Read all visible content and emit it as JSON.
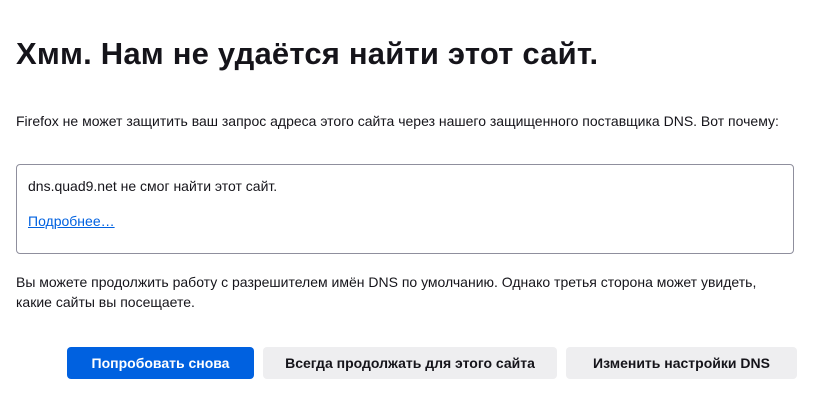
{
  "error_page": {
    "title": "Хмм. Нам не удаётся найти этот сайт.",
    "description": "Firefox не может защитить ваш запрос адреса этого сайта через нашего защищенного поставщика DNS. Вот почему:",
    "detail": {
      "message": "dns.quad9.net не смог найти этот сайт.",
      "learn_more_label": "Подробнее…"
    },
    "fallback_text": "Вы можете продолжить работу с разрешителем имён DNS по умолчанию. Однако третья сторона может увидеть, какие сайты вы посещаете."
  },
  "buttons": {
    "retry_label": "Попробовать снова",
    "always_continue_label": "Всегда продолжать для этого сайта",
    "dns_settings_label": "Изменить настройки DNS"
  },
  "colors": {
    "primary": "#0061e0",
    "secondary_button": "#eeeef0",
    "text": "#15141a",
    "border": "#8f8f9d"
  }
}
